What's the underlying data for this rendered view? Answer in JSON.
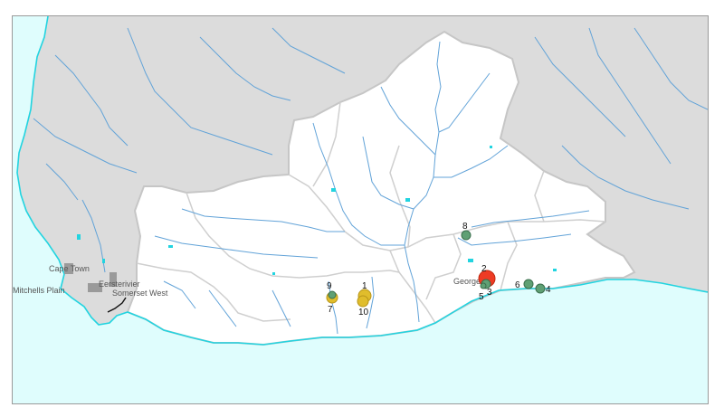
{
  "map": {
    "colors": {
      "sea": "#dffdfd",
      "land_outside": "#dcdcdc",
      "region": "#ffffff",
      "boundary": "#c8c8c8",
      "rivers": "#62a3d8",
      "coast": "#22d4e0",
      "site_green": "#5fa074",
      "site_yellow": "#e0bd2c",
      "site_red": "#ee3b24"
    },
    "city_labels": [
      {
        "id": "cape-town",
        "text": "Cape Town"
      },
      {
        "id": "mitchells-plain",
        "text": "Mitchells Plain"
      },
      {
        "id": "eersterivier",
        "text": "Eersterivier"
      },
      {
        "id": "somerset-west",
        "text": "Somerset West"
      },
      {
        "id": "george",
        "text": "George"
      }
    ],
    "sites": [
      {
        "label": "1",
        "color": "yellow"
      },
      {
        "label": "2",
        "color": "red"
      },
      {
        "label": "3",
        "color": "green"
      },
      {
        "label": "4",
        "color": "green"
      },
      {
        "label": "5",
        "color": "green"
      },
      {
        "label": "6",
        "color": "green"
      },
      {
        "label": "7",
        "color": "yellow"
      },
      {
        "label": "8",
        "color": "green"
      },
      {
        "label": "9",
        "color": "green"
      },
      {
        "label": "10",
        "color": "yellow"
      }
    ]
  }
}
